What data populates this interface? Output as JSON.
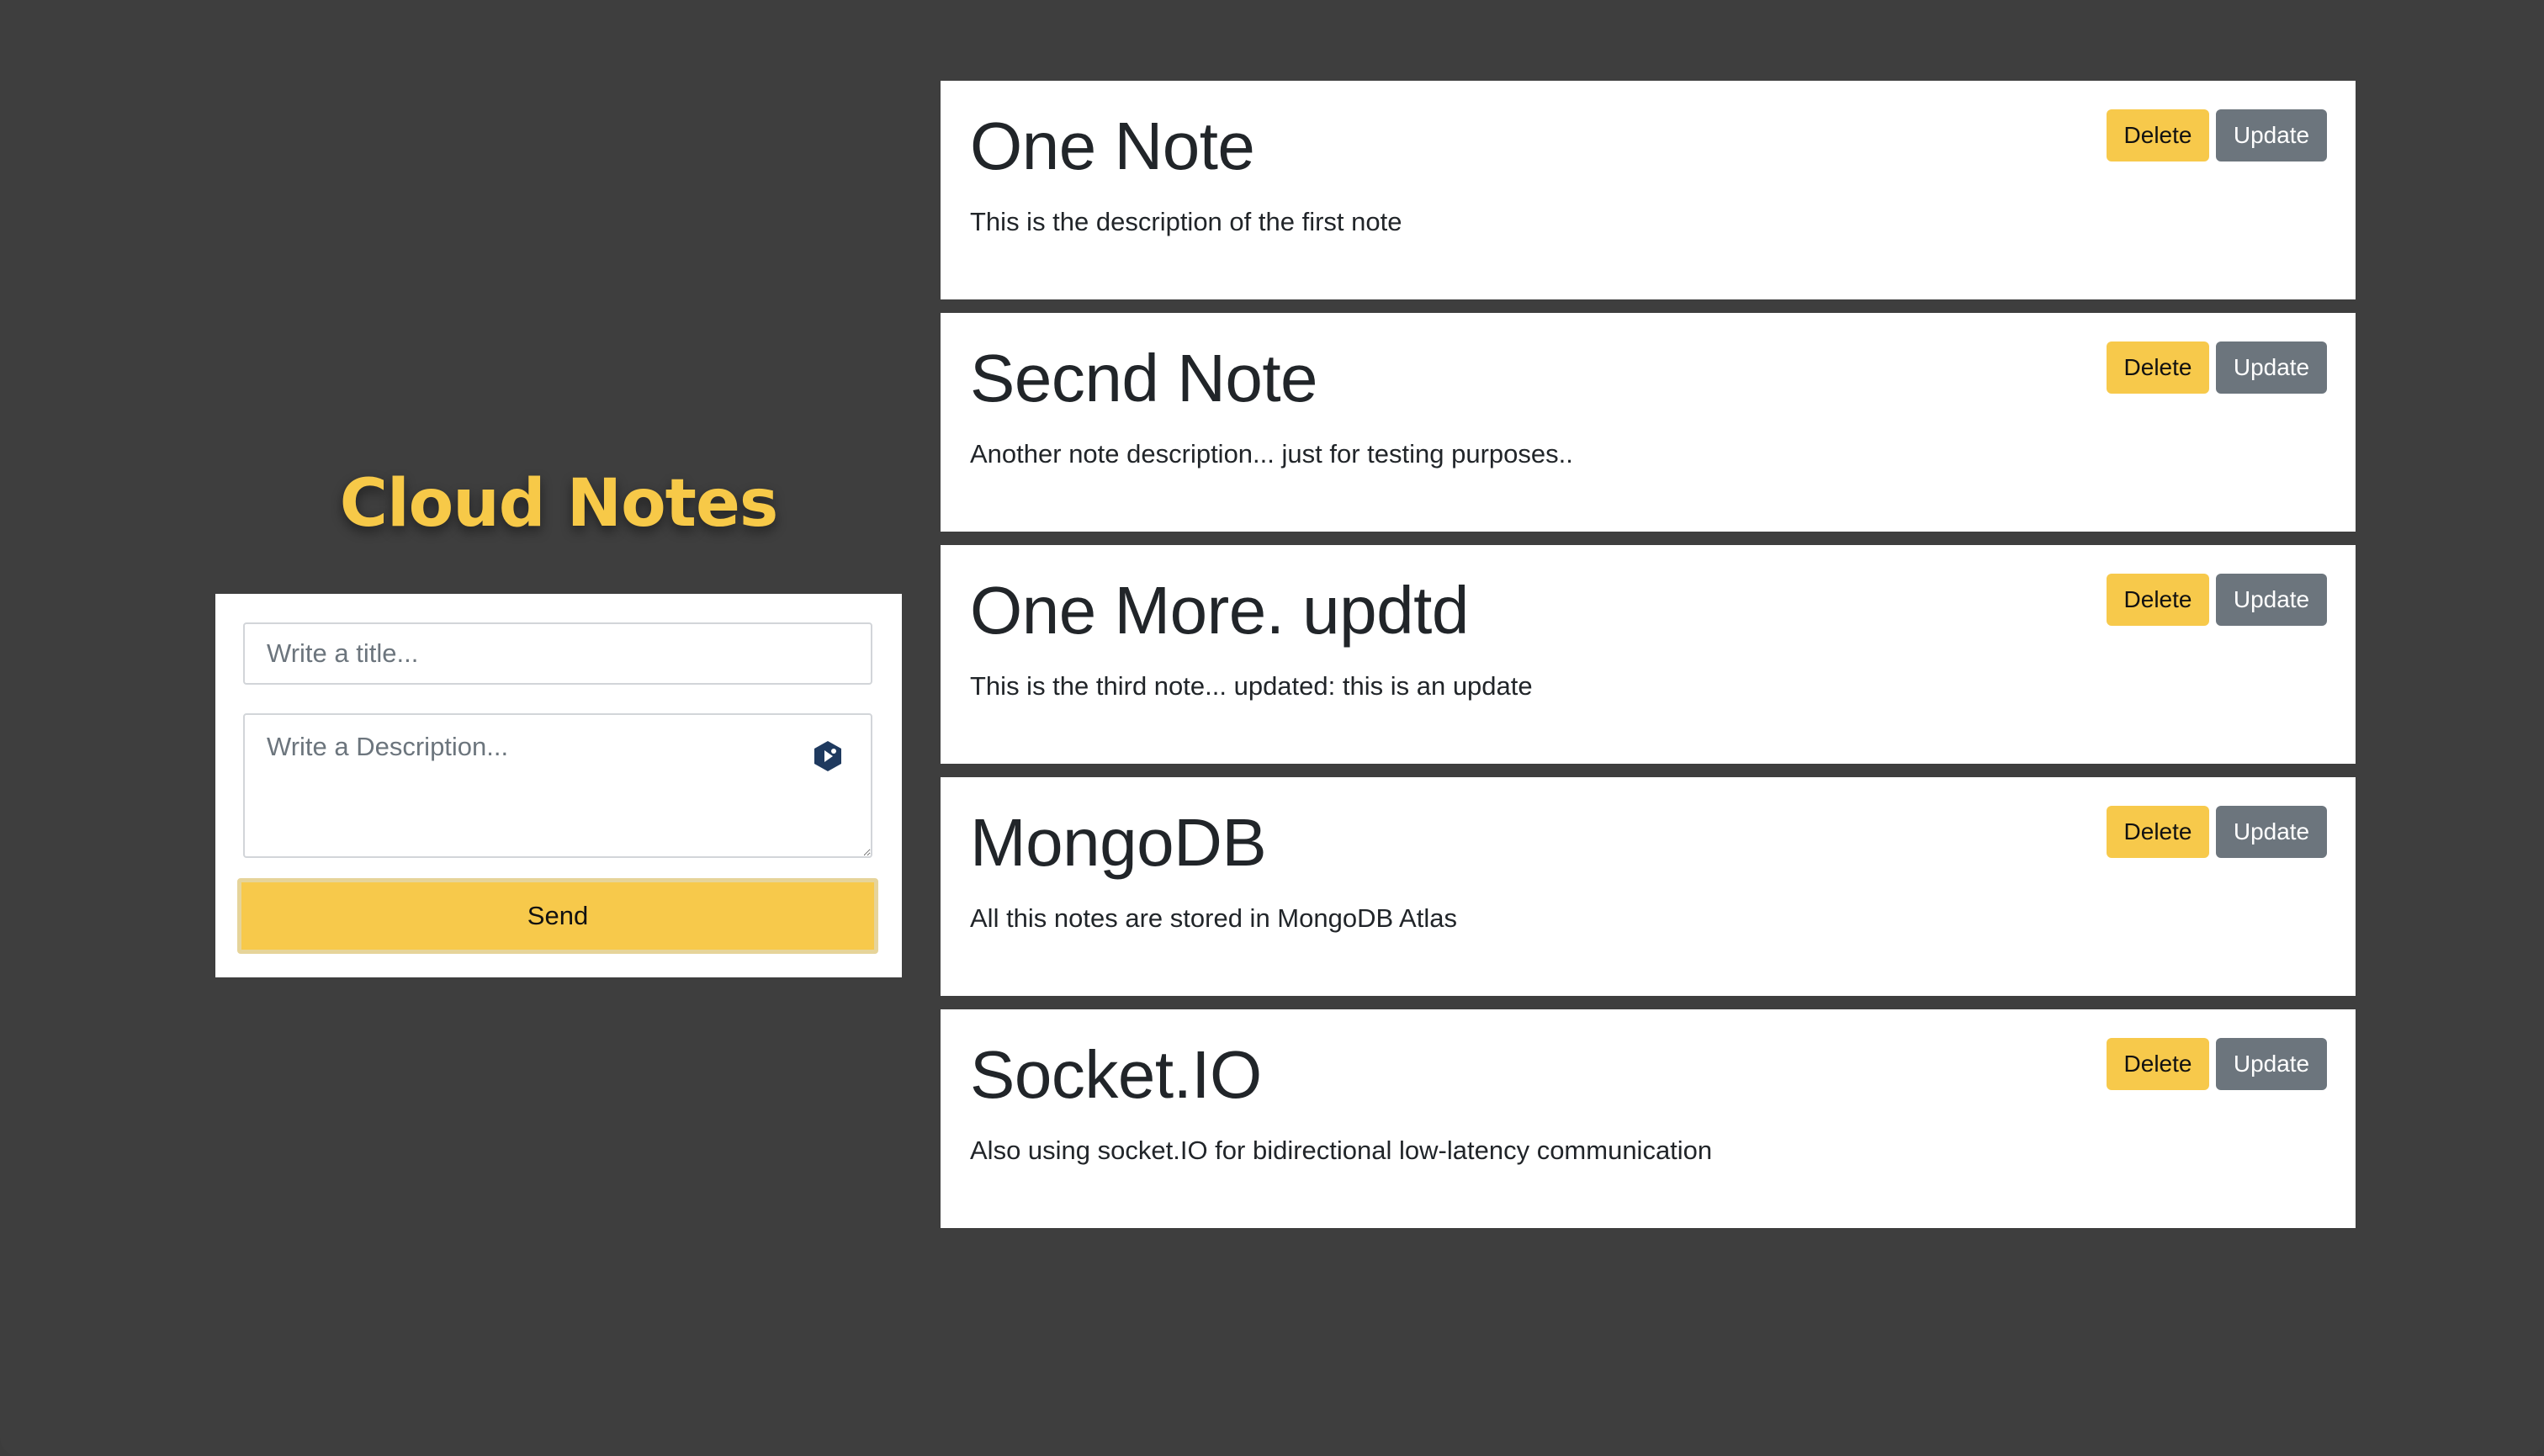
{
  "app": {
    "title": "Cloud Notes"
  },
  "form": {
    "title_placeholder": "Write a title...",
    "title_value": "",
    "description_placeholder": "Write a Description...",
    "description_value": "",
    "send_label": "Send",
    "extension_icon": "assistant-extension-icon"
  },
  "notes": [
    {
      "title": "One Note",
      "description": "This is the description of the first note",
      "delete_label": "Delete",
      "update_label": "Update"
    },
    {
      "title": "Secnd Note",
      "description": "Another note description... just for testing purposes..",
      "delete_label": "Delete",
      "update_label": "Update"
    },
    {
      "title": "One More. updtd",
      "description": "This is the third note... updated: this is an update",
      "delete_label": "Delete",
      "update_label": "Update"
    },
    {
      "title": "MongoDB",
      "description": "All this notes are stored in MongoDB Atlas",
      "delete_label": "Delete",
      "update_label": "Update"
    },
    {
      "title": "Socket.IO",
      "description": "Also using socket.IO for bidirectional low-latency communication",
      "delete_label": "Delete",
      "update_label": "Update"
    }
  ],
  "colors": {
    "background": "#3e3e3e",
    "accent": "#f7c948",
    "secondary_button": "#6c757d",
    "card": "#ffffff"
  }
}
